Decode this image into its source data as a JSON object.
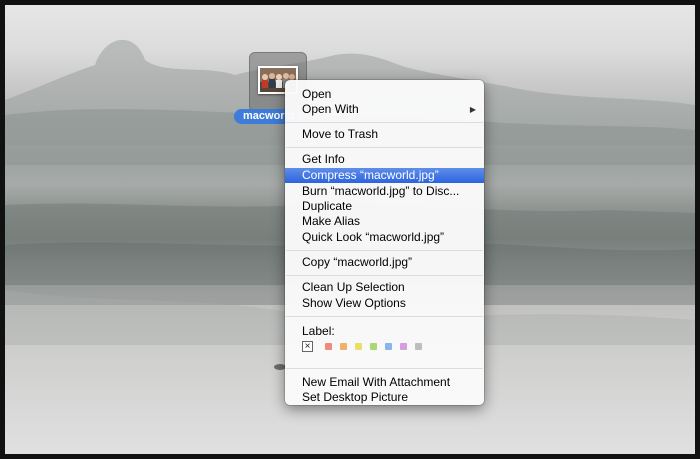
{
  "desktop": {
    "icon_label": "macworld.jpg"
  },
  "menu": {
    "open": "Open",
    "open_with": "Open With",
    "move_to_trash": "Move to Trash",
    "get_info": "Get Info",
    "compress": "Compress “macworld.jpg”",
    "burn": "Burn “macworld.jpg” to Disc...",
    "duplicate": "Duplicate",
    "make_alias": "Make Alias",
    "quick_look": "Quick Look “macworld.jpg”",
    "copy": "Copy “macworld.jpg”",
    "clean_up": "Clean Up Selection",
    "show_view_options": "Show View Options",
    "label_title": "Label:",
    "new_email": "New Email With Attachment",
    "set_desktop": "Set Desktop Picture"
  },
  "label_colors": {
    "none": "×",
    "red": "#f08a80",
    "orange": "#f3b06a",
    "yellow": "#ecde6a",
    "green": "#a9d775",
    "blue": "#8ab4ec",
    "purple": "#d4a0dc",
    "gray": "#bdbdbd"
  },
  "colors": {
    "selection": "#2c64e0",
    "icon_label_bg": "#3d7cd8"
  }
}
